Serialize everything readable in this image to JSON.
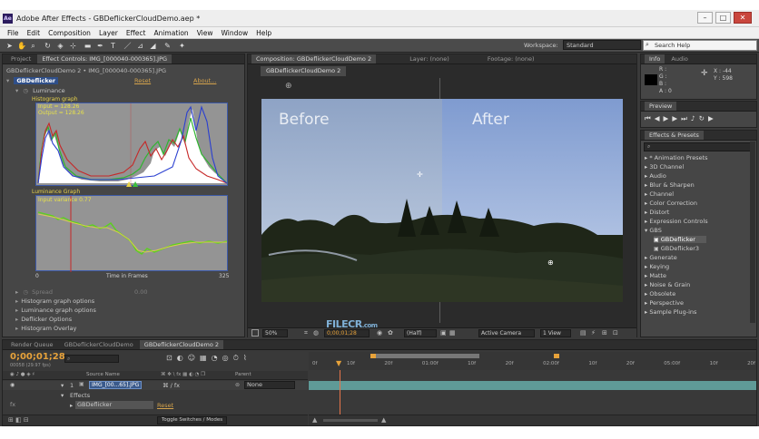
{
  "window": {
    "title": "Adobe After Effects - GBDeflickerCloudDemo.aep *",
    "app_icon": "Ae"
  },
  "menu": [
    "File",
    "Edit",
    "Composition",
    "Layer",
    "Effect",
    "Animation",
    "View",
    "Window",
    "Help"
  ],
  "toolbar": {
    "workspace_label": "Workspace:",
    "workspace_value": "Standard",
    "search_placeholder": "Search Help"
  },
  "left_panel": {
    "tabs": [
      "Project",
      "Effect Controls: IMG_[000040-000365].JPG"
    ],
    "subtitle": "GBDeflickerCloudDemo 2 • IMG_[000040-000365].JPG",
    "effect_name": "GBDeflicker",
    "reset": "Reset",
    "about": "About...",
    "luminance": "Luminance",
    "histogram_title": "Histogram graph",
    "histogram_input": "Input = 128.26",
    "histogram_output": "Output = 128.26",
    "lum_graph_title": "Luminance Graph",
    "lum_input": "Input variance 0.77",
    "axis_start": "0",
    "axis_label": "Time in Frames",
    "axis_end": "325",
    "spread_label": "Spread",
    "spread_value": "0.00",
    "options": [
      "Histogram graph options",
      "Luminance graph options",
      "Deflicker Options",
      "Histogram Overlay"
    ]
  },
  "comp_panel": {
    "tabs": [
      "Composition: GBDeflickerCloudDemo 2",
      "Layer: (none)",
      "Footage: (none)"
    ],
    "subtab": "GBDeflickerCloudDemo 2",
    "before": "Before",
    "after": "After",
    "zoom": "50%",
    "timecode": "0;00;01;28",
    "resolution": "(Half)",
    "camera": "Active Camera",
    "view": "1 View"
  },
  "info_panel": {
    "tabs": [
      "Info",
      "Audio"
    ],
    "r": "R :",
    "g": "G :",
    "b": "B :",
    "a": "A : 0",
    "x": "X : -44",
    "y": "Y : 598"
  },
  "preview_panel": {
    "title": "Preview"
  },
  "effects_panel": {
    "title": "Effects & Presets",
    "items": [
      "* Animation Presets",
      "3D Channel",
      "Audio",
      "Blur & Sharpen",
      "Channel",
      "Color Correction",
      "Distort",
      "Expression Controls",
      "GBS",
      "GBDeflicker",
      "GBDeflicker3",
      "Generate",
      "Keying",
      "Matte",
      "Noise & Grain",
      "Obsolete",
      "Perspective",
      "Sample Plug-ins"
    ]
  },
  "timeline": {
    "tabs": [
      "Render Queue",
      "GBDeflickerCloudDemo",
      "GBDeflickerCloudDemo 2"
    ],
    "timecode": "0;00;01;28",
    "timecode_sub": "00058 (29.97 fps)",
    "col_source": "Source Name",
    "col_parent": "Parent",
    "layer_num": "1",
    "layer_name": "IMG_[00...65].JPG",
    "parent_value": "None",
    "effects_label": "Effects",
    "effect_row": "GBDeflicker",
    "reset": "Reset",
    "toggle": "Toggle Switches / Modes",
    "ruler": [
      "0f",
      "10f",
      "20f",
      "01:00f",
      "10f",
      "20f",
      "02:00f",
      "10f",
      "20f",
      "05:00f",
      "10f",
      "20f"
    ]
  },
  "watermark": "FILECR",
  "watermark_sub": ".com"
}
